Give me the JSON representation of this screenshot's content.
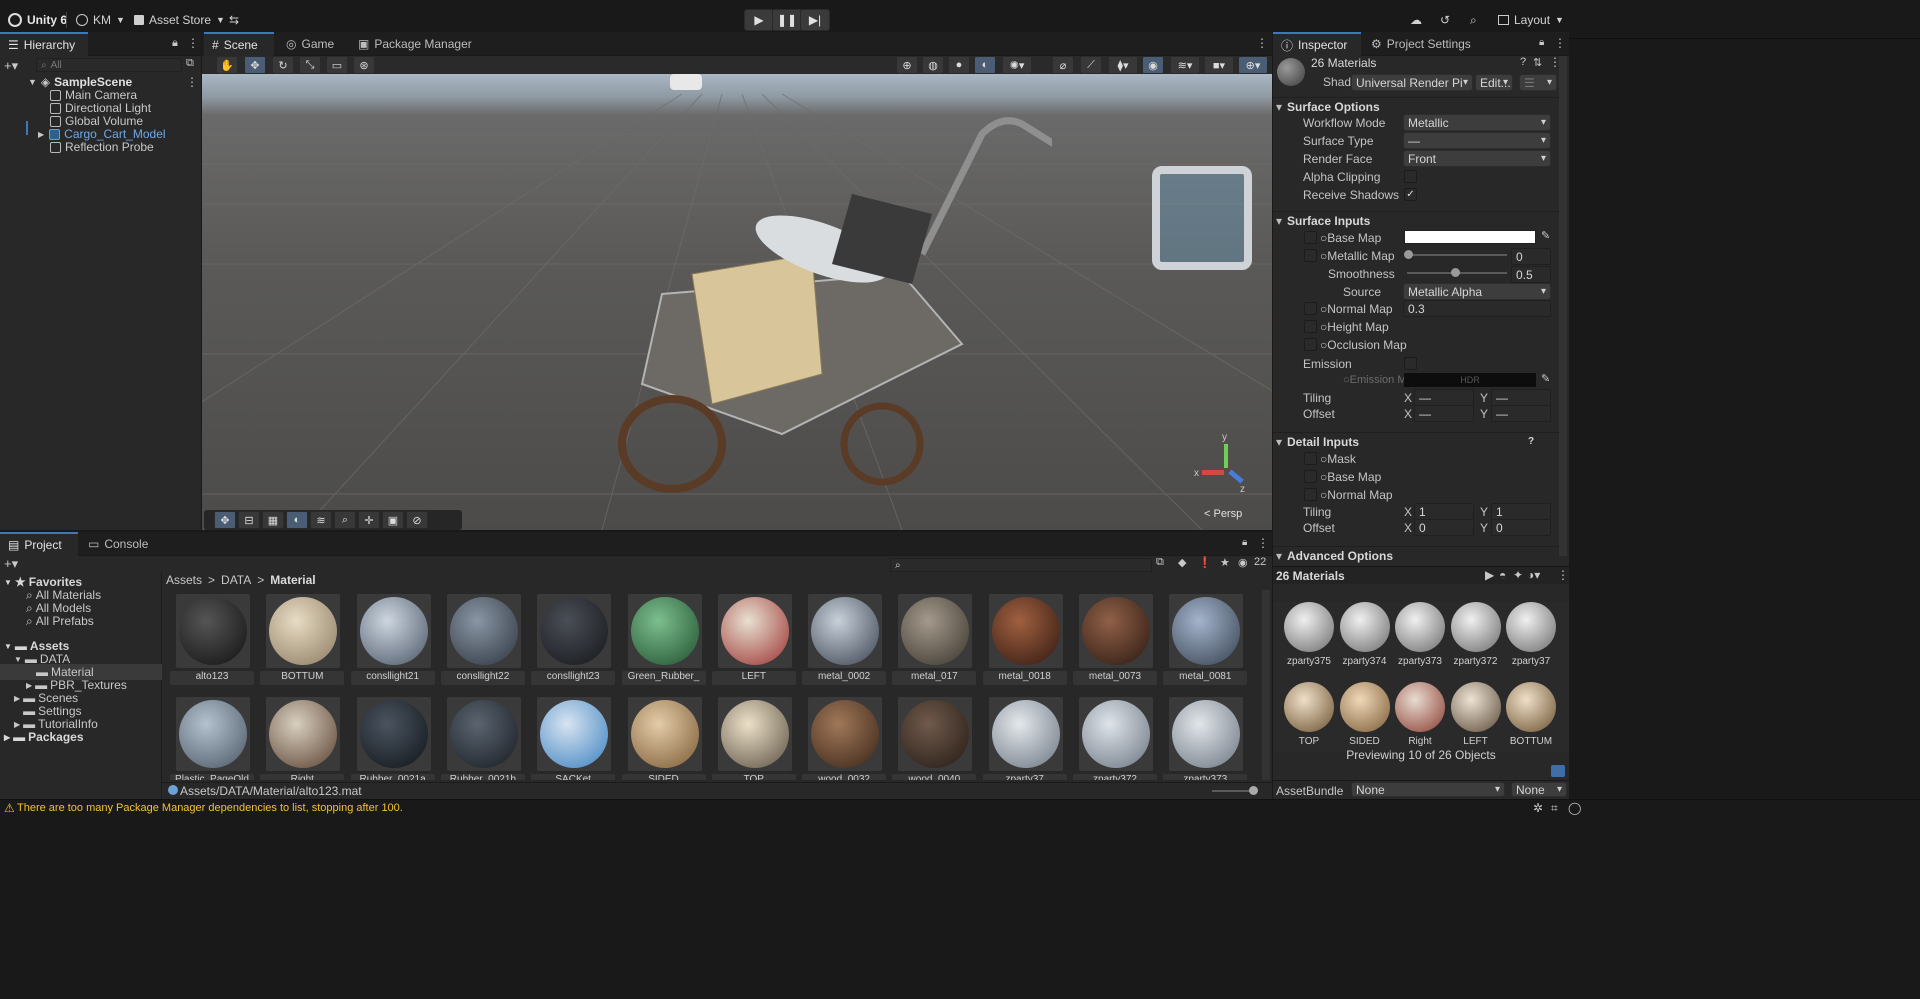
{
  "toolbar": {
    "app_name": "Unity 6",
    "account": "KM",
    "asset_store": "Asset Store",
    "layout": "Layout"
  },
  "hierarchy": {
    "tab": "Hierarchy",
    "search_placeholder": "All",
    "scene": "SampleScene",
    "items": [
      "Main Camera",
      "Directional Light",
      "Global Volume",
      "Cargo_Cart_Model",
      "Reflection Probe"
    ]
  },
  "scene_tabs": {
    "scene": "Scene",
    "game": "Game",
    "package_manager": "Package Manager"
  },
  "scene_view": {
    "persp": "< Persp",
    "gizmo_y": "y",
    "gizmo_x": "x",
    "gizmo_z": "z"
  },
  "inspector": {
    "tab": "Inspector",
    "tab2": "Project Settings",
    "title": "26 Materials",
    "shader_label": "Shader",
    "shader_value": "Universal Render Pipelin",
    "edit": "Edit...",
    "surface_options": "Surface Options",
    "workflow_mode": "Workflow Mode",
    "workflow_value": "Metallic",
    "surface_type": "Surface Type",
    "surface_type_value": "—",
    "render_face": "Render Face",
    "render_face_value": "Front",
    "alpha_clipping": "Alpha Clipping",
    "receive_shadows": "Receive Shadows",
    "receive_check": "✓",
    "surface_inputs": "Surface Inputs",
    "base_map": "Base Map",
    "metallic_map": "Metallic Map",
    "metallic_value": "0",
    "smoothness": "Smoothness",
    "smoothness_value": "0.5",
    "source": "Source",
    "source_value": "Metallic Alpha",
    "normal_map": "Normal Map",
    "normal_value": "0.3",
    "height_map": "Height Map",
    "occlusion_map": "Occlusion Map",
    "emission": "Emission",
    "emission_map": "Emission M",
    "hdr": "HDR",
    "tiling": "Tiling",
    "offset": "Offset",
    "x": "X",
    "y": "Y",
    "dash": "—",
    "detail_inputs": "Detail Inputs",
    "mask": "Mask",
    "d_base_map": "Base Map",
    "d_normal_map": "Normal Map",
    "d_tiling_x": "1",
    "d_tiling_y": "1",
    "d_offset_x": "0",
    "d_offset_y": "0",
    "advanced": "Advanced Options",
    "preview_title": "26 Materials",
    "previews": [
      "zparty375",
      "zparty374",
      "zparty373",
      "zparty372",
      "zparty37",
      "TOP",
      "SIDED",
      "Right",
      "LEFT",
      "BOTTUM"
    ],
    "previewing": "Previewing 10 of 26 Objects",
    "assetbundle": "AssetBundle",
    "ab_value": "None",
    "ab_value2": "None"
  },
  "project": {
    "tab": "Project",
    "tab2": "Console",
    "favorites": "Favorites",
    "fav_items": [
      "All Materials",
      "All Models",
      "All Prefabs"
    ],
    "assets": "Assets",
    "data": "DATA",
    "material": "Material",
    "pbr": "PBR_Textures",
    "scenes": "Scenes",
    "settings": "Settings",
    "tutorial": "TutorialInfo",
    "packages": "Packages",
    "breadcrumb": [
      "Assets",
      "DATA",
      "Material"
    ],
    "hidden_count": "22",
    "row1": [
      "alto123",
      "BOTTUM",
      "consllight21",
      "consllight22",
      "consllight23",
      "Green_Rubber_",
      "LEFT",
      "metal_0002",
      "metal_017",
      "metal_0018",
      "metal_0073",
      "metal_0081"
    ],
    "row2": [
      "Plastic_PageOld",
      "Right",
      "Rubber_0021a",
      "Rubber_0021b",
      "SACKet",
      "SIDED",
      "TOP",
      "wood_0032",
      "wood_0040",
      "zparty37",
      "zparty372",
      "zparty373"
    ],
    "path": "Assets/DATA/Material/alto123.mat"
  },
  "status": {
    "warning": "There are too many Package Manager dependencies to list, stopping after 100."
  }
}
